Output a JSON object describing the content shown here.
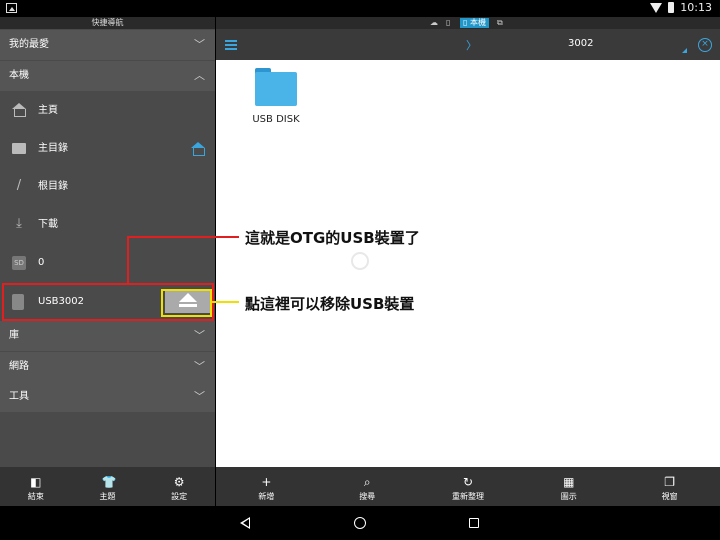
{
  "status_bar": {
    "time": "10:13"
  },
  "drawer": {
    "title": "快捷導航",
    "sections": [
      {
        "label": "我的最愛",
        "chevron": "chevron-down-icon"
      },
      {
        "label": "本機",
        "chevron": "chevron-up-icon"
      },
      {
        "label": "庫",
        "chevron": "chevron-down-icon"
      },
      {
        "label": "網路",
        "chevron": "chevron-down-icon"
      },
      {
        "label": "工具",
        "chevron": "chevron-down-icon"
      }
    ],
    "items": [
      {
        "label": "主頁",
        "icon": "home-icon"
      },
      {
        "label": "主目錄",
        "icon": "folder-icon"
      },
      {
        "label": "根目錄",
        "icon": "slash-icon"
      },
      {
        "label": "下載",
        "icon": "download-icon"
      },
      {
        "label": "0",
        "icon": "sd-card-icon"
      },
      {
        "label": "USB3002",
        "icon": "usb-icon"
      }
    ],
    "bottom": [
      {
        "label": "結束",
        "icon": "exit-icon"
      },
      {
        "label": "主題",
        "icon": "shirt-icon"
      },
      {
        "label": "設定",
        "icon": "gear-icon"
      }
    ]
  },
  "window_tabs": {
    "active_label": "本機"
  },
  "toolbar": {
    "separator": "〉",
    "path": "3002"
  },
  "files": [
    {
      "name": "USB DISK",
      "icon": "folder-icon"
    }
  ],
  "main_bottom": [
    {
      "label": "新增",
      "icon": "plus-icon",
      "glyph": "+"
    },
    {
      "label": "搜尋",
      "icon": "search-icon",
      "glyph": "⌕"
    },
    {
      "label": "重新整理",
      "icon": "refresh-icon",
      "glyph": "↻"
    },
    {
      "label": "圖示",
      "icon": "grid-icon",
      "glyph": "▦"
    },
    {
      "label": "視窗",
      "icon": "windows-icon",
      "glyph": "❐"
    }
  ],
  "annotations": {
    "red": "這就是OTG的USB裝置了",
    "yellow": "點這裡可以移除USB裝置"
  },
  "colors": {
    "accent": "#3aa6e0",
    "red": "#e02020",
    "yellow": "#f0e000"
  }
}
